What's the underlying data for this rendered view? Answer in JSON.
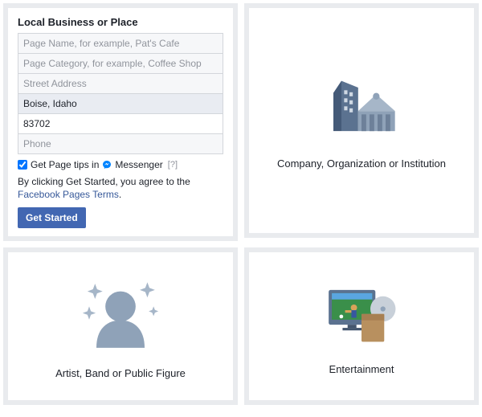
{
  "local_business": {
    "title": "Local Business or Place",
    "fields": {
      "page_name": {
        "placeholder": "Page Name, for example, Pat's Cafe",
        "value": ""
      },
      "page_category": {
        "placeholder": "Page Category, for example, Coffee Shop",
        "value": ""
      },
      "street_address": {
        "placeholder": "Street Address",
        "value": ""
      },
      "city": {
        "placeholder": "",
        "value": "Boise, Idaho"
      },
      "zip": {
        "placeholder": "",
        "value": "83702"
      },
      "phone": {
        "placeholder": "Phone",
        "value": ""
      }
    },
    "tips_checkbox": {
      "checked": true,
      "label_pre": "Get Page tips in",
      "label_brand": "Messenger",
      "help": "[?]"
    },
    "terms_text": "By clicking Get Started, you agree to the ",
    "terms_link": "Facebook Pages Terms",
    "terms_suffix": ".",
    "cta": "Get Started"
  },
  "cards": {
    "company": {
      "label": "Company, Organization or Institution"
    },
    "artist": {
      "label": "Artist, Band or Public Figure"
    },
    "entertainment": {
      "label": "Entertainment"
    }
  }
}
